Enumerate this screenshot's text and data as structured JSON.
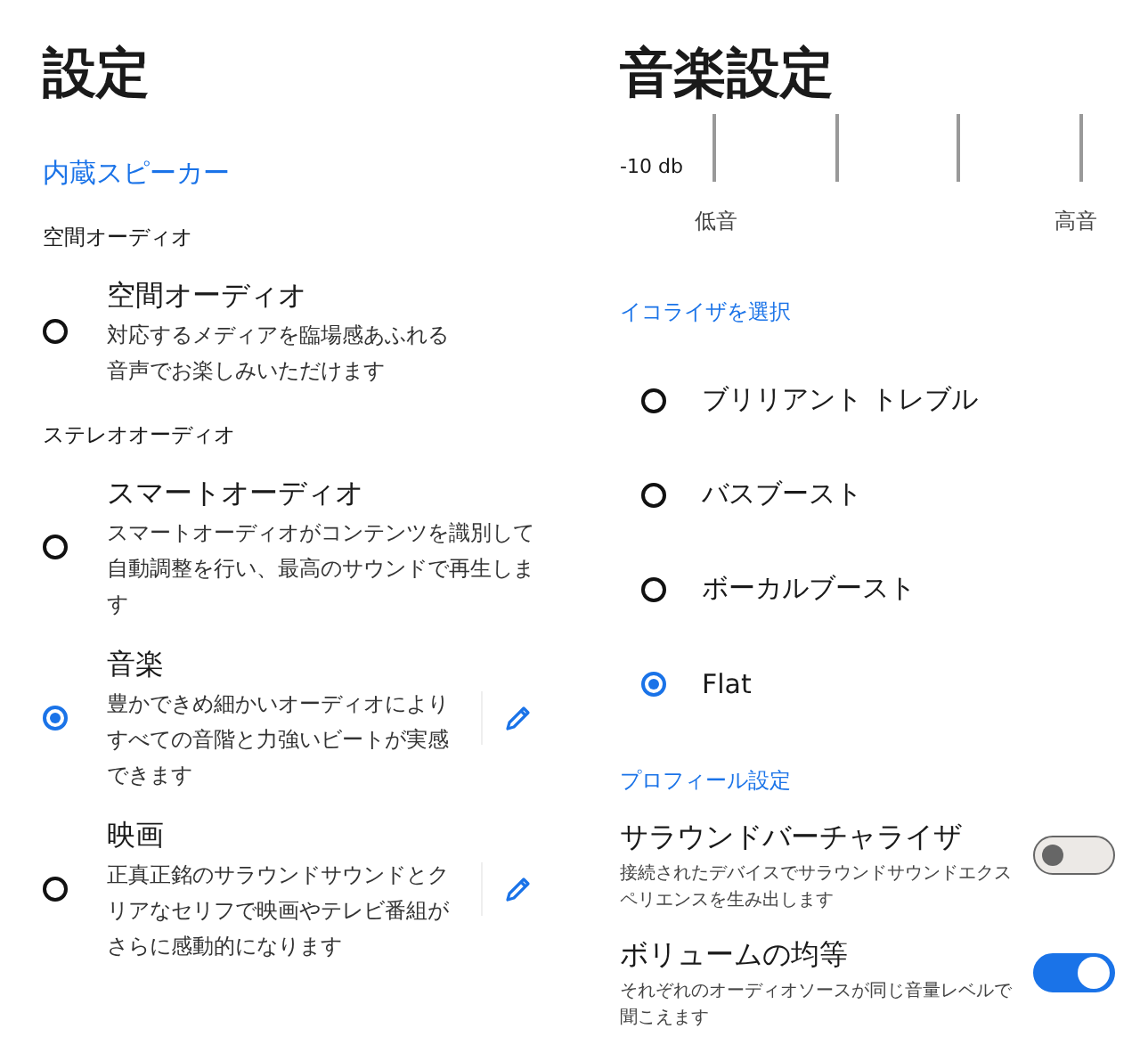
{
  "left": {
    "title": "設定",
    "section": "内蔵スピーカー",
    "groups": [
      {
        "header": "空間オーディオ",
        "items": [
          {
            "title": "空間オーディオ",
            "description": "対応するメディアを臨場感あふれる音声でお楽しみいただけます",
            "selected": false,
            "editable": false
          }
        ]
      },
      {
        "header": "ステレオオーディオ",
        "items": [
          {
            "title": "スマートオーディオ",
            "description": "スマートオーディオがコンテンツを識別して自動調整を行い、最高のサウンドで再生します",
            "selected": false,
            "editable": false
          },
          {
            "title": "音楽",
            "description": "豊かできめ細かいオーディオによりすべての音階と力強いビートが実感できます",
            "selected": true,
            "editable": true
          },
          {
            "title": "映画",
            "description": "正真正銘のサラウンドサウンドとクリアなセリフで映画やテレビ番組がさらに感動的になります",
            "selected": false,
            "editable": true
          }
        ]
      }
    ]
  },
  "right": {
    "title": "音楽設定",
    "equalizer": {
      "db_label": "-10 db",
      "low_label": "低音",
      "high_label": "高音"
    },
    "preset_section": "イコライザを選択",
    "presets": [
      {
        "label": "ブリリアント トレブル",
        "selected": false
      },
      {
        "label": "バスブースト",
        "selected": false
      },
      {
        "label": "ボーカルブースト",
        "selected": false
      },
      {
        "label": "Flat",
        "selected": true
      }
    ],
    "profile_section": "プロフィール設定",
    "toggles": [
      {
        "title": "サラウンドバーチャライザ",
        "description": "接続されたデバイスでサラウンドサウンドエクスペリエンスを生み出します",
        "on": false
      },
      {
        "title": "ボリュームの均等",
        "description": "それぞれのオーディオソースが同じ音量レベルで聞こえます",
        "on": true
      }
    ]
  }
}
